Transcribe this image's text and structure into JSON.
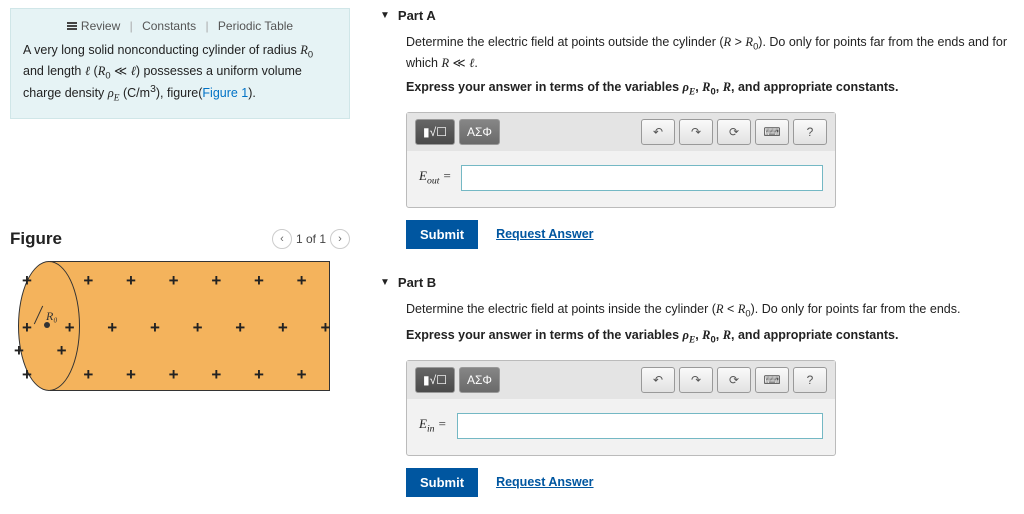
{
  "info": {
    "review": "Review",
    "constants": "Constants",
    "periodic": "Periodic Table",
    "problem_html": "A very long solid nonconducting cylinder of radius <span class='ital'>R</span><sub>0</sub> and length <span class='ital'>ℓ</span> (<span class='ital'>R</span><sub>0</sub> ≪ <span class='ital'>ℓ</span>) possesses a uniform volume charge density <span class='ital'>ρ<sub>E</sub></span> (C/m<sup>3</sup>), figure(<span class='fig-link' data-name='figure-1-link' data-interactable='true'>Figure 1</span>)."
  },
  "figure": {
    "title": "Figure",
    "pager": "1 of 1",
    "r0": "R₀"
  },
  "toolbar": {
    "templates": "▮√☐",
    "greek": "ΑΣΦ",
    "undo": "↶",
    "redo": "↷",
    "reset": "⟳",
    "keyboard": "⌨",
    "help": "?"
  },
  "partA": {
    "title": "Part A",
    "q_html": "Determine the electric field at points outside the cylinder (<span class='ital'>R</span> > <span class='ital'>R</span><sub>0</sub>). Do only for points far from the ends and for which <span class='ital'>R</span> ≪ <span class='ital'>ℓ</span>.",
    "instr_html": "Express your answer in terms of the variables <span class='ital'>ρ<sub>E</sub></span>, <span class='ital'>R</span><sub>0</sub>, <span class='ital'>R</span>, and appropriate constants.",
    "label_html": "<span class='ital'>E</span><sub>out</sub> =",
    "value": ""
  },
  "partB": {
    "title": "Part B",
    "q_html": "Determine the electric field at points inside the cylinder (<span class='ital'>R</span> < <span class='ital'>R</span><sub>0</sub>). Do only for points far from the ends.",
    "instr_html": "Express your answer in terms of the variables <span class='ital'>ρ<sub>E</sub></span>, <span class='ital'>R</span><sub>0</sub>, <span class='ital'>R</span>, and appropriate constants.",
    "label_html": "<span class='ital'>E</span><sub>in</sub> =",
    "value": ""
  },
  "buttons": {
    "submit": "Submit",
    "request": "Request Answer"
  }
}
